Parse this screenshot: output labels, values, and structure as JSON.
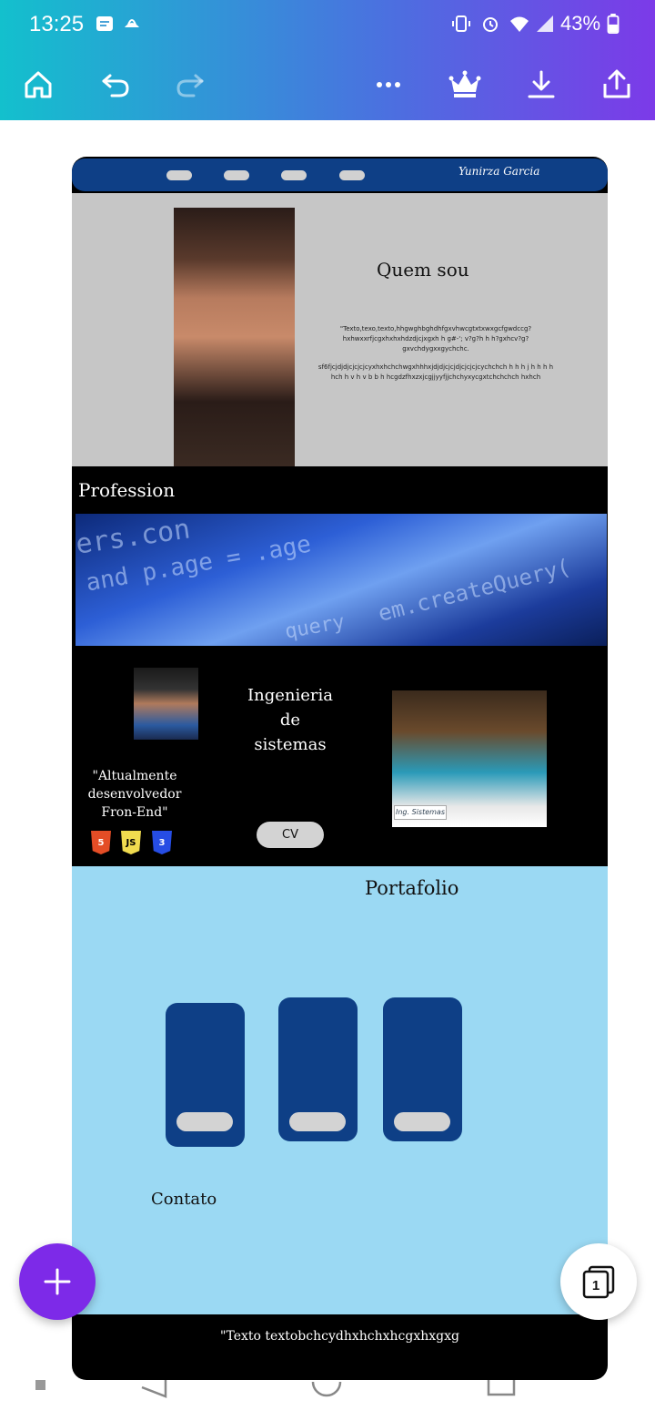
{
  "status_bar": {
    "time": "13:25",
    "battery": "43%"
  },
  "toolbar": {
    "icons": [
      "home-icon",
      "undo-icon",
      "redo-icon",
      "more-icon",
      "crown-icon",
      "download-icon",
      "share-icon"
    ]
  },
  "design": {
    "nav": {
      "name": "Yunirza Garcia"
    },
    "about": {
      "title": "Quem sou",
      "text1": "\"Texto,texo,texto,hhgwghbghdhfgxvhwcgtxtxwxgcfgwdccg? hxhwxxrfjcgxhxhxhdzdjcjxgxh h g#-'; v?g?h h h?gxhcv?g? gxvchdygxxgychchc.",
      "text2": "sf6fjcjdjdjcjcjcjcyxhxhchchwgxhhhxjdjdjcjcjdjcjcjcjcychchch h h h j h h h h hch h v h v b b h hcgdzfhxzxjcgjjyyfjjchchyxycgxtchchchch hxhch"
    },
    "profession": {
      "title": "Profession",
      "banner_text": [
        "ers.con",
        "and p.age = .age",
        "query",
        "em.createQuery("
      ]
    },
    "degree": {
      "title": "Ingenieria de sistemas",
      "quote": "\"Altualmente desenvolvedor Fron-End\"",
      "tech": [
        "5",
        "JS",
        "3"
      ],
      "cv_label": "CV",
      "desk_sign": "Ing. Sistemas"
    },
    "portfolio": {
      "title": "Portafolio",
      "contact_title": "Contato"
    },
    "footer": {
      "text": "\"Texto textobchcydhxhchxhcgxhxgxg"
    }
  },
  "pages": {
    "count": "1"
  },
  "colors": {
    "brand_blue": "#0e3f86",
    "purple": "#7d2ae8",
    "light_blue": "#9bd9f3"
  }
}
